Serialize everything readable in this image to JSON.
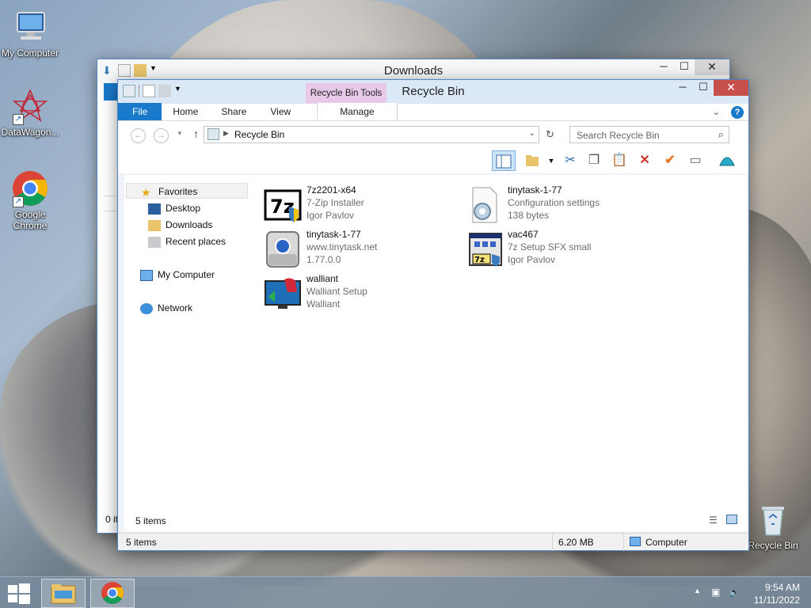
{
  "desktop": {
    "icons": [
      {
        "label": "My Computer",
        "icon": "computer-icon"
      },
      {
        "label": "DataWagon...",
        "icon": "datawagon-icon"
      },
      {
        "label": "Google Chrome",
        "icon": "chrome-icon"
      },
      {
        "label": "Recycle Bin",
        "icon": "recycle-bin-icon"
      }
    ]
  },
  "downloads_window": {
    "title": "Downloads",
    "status_items": "0 it"
  },
  "recycle_window": {
    "title": "Recycle Bin",
    "tabs": [
      "File",
      "Home",
      "Share",
      "View",
      "Manage"
    ],
    "contextual_tab_group": "Recycle Bin Tools",
    "address": "Recycle Bin",
    "search_placeholder": "Search Recycle Bin",
    "nav": {
      "favorites": "Favorites",
      "desktop": "Desktop",
      "downloads": "Downloads",
      "recent": "Recent places",
      "computer": "My Computer",
      "network": "Network"
    },
    "files": [
      {
        "name": "7z2201-x64",
        "line2": "7-Zip Installer",
        "line3": "Igor Pavlov",
        "icon": "7zip-installer-icon"
      },
      {
        "name": "tinytask-1-77",
        "line2": "Configuration settings",
        "line3": "138 bytes",
        "icon": "config-settings-icon"
      },
      {
        "name": "tinytask-1-77",
        "line2": "www.tinytask.net",
        "line3": "1.77.0.0",
        "icon": "tinytask-icon"
      },
      {
        "name": "vac467",
        "line2": "7z Setup SFX small",
        "line3": "Igor Pavlov",
        "icon": "7z-sfx-icon"
      },
      {
        "name": "walliant",
        "line2": "Walliant Setup",
        "line3": "Walliant",
        "icon": "walliant-icon"
      }
    ],
    "inner_status": "5 items",
    "status": {
      "items": "5 items",
      "size": "6.20 MB",
      "location": "Computer"
    }
  },
  "taskbar": {
    "time": "9:54 AM",
    "date": "11/11/2022"
  },
  "colors": {
    "ribbon_file_tab": "#1979ca",
    "contextual_tab": "#e8c9ea",
    "close_button": "#c7504b",
    "window_border": "#5a86b8"
  }
}
